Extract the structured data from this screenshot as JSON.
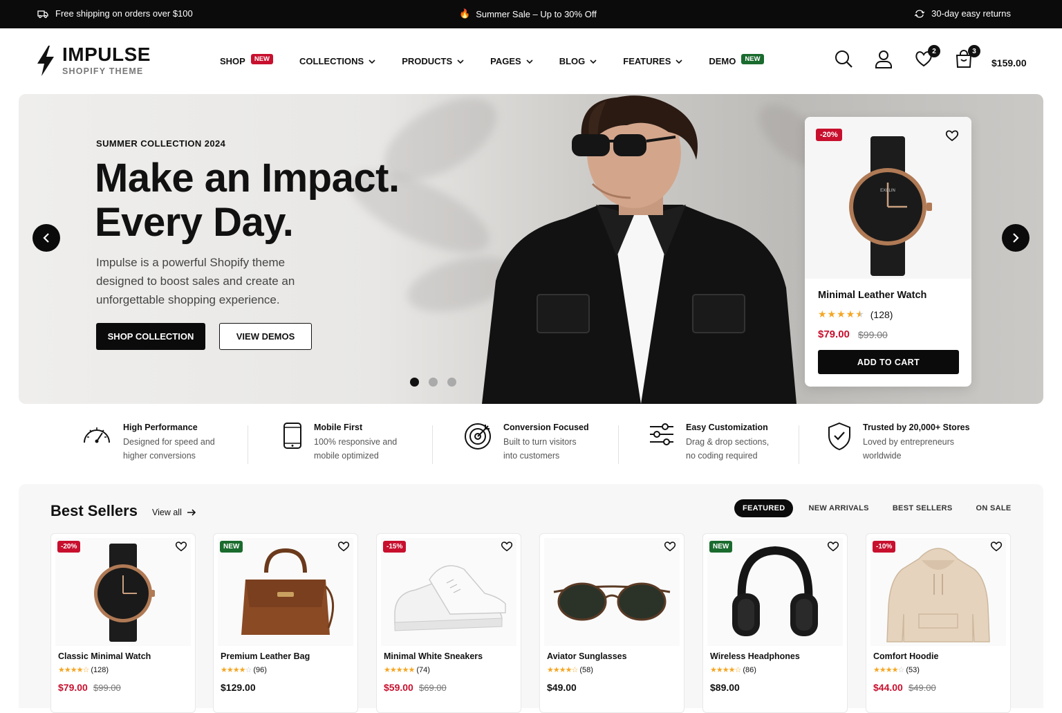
{
  "topbar": {
    "shipping": "Free shipping on orders over $100",
    "sale": "Summer Sale – Up to 30% Off",
    "returns": "30-day easy returns"
  },
  "logo": {
    "name": "IMPULSE",
    "tagline": "SHOPIFY THEME"
  },
  "nav": [
    {
      "label": "SHOP",
      "badge": "NEW",
      "badge_color": "#c8102e"
    },
    {
      "label": "COLLECTIONS",
      "chevron": true
    },
    {
      "label": "PRODUCTS",
      "chevron": true
    },
    {
      "label": "PAGES",
      "chevron": true
    },
    {
      "label": "BLOG",
      "chevron": true
    },
    {
      "label": "FEATURES",
      "chevron": true
    },
    {
      "label": "DEMO",
      "badge": "NEW",
      "badge_color": "#1a6b2e"
    }
  ],
  "header": {
    "wishlist_count": "2",
    "cart_count": "3",
    "cart_total": "$159.00"
  },
  "hero": {
    "kicker": "SUMMER COLLECTION 2024",
    "title_line1": "Make an Impact.",
    "title_line2": "Every Day.",
    "description": "Impulse is a powerful Shopify theme designed to boost sales and create an unforgettable shopping experience.",
    "primary_button": "SHOP COLLECTION",
    "secondary_button": "VIEW DEMOS",
    "slides": 3,
    "active_slide": 0,
    "product": {
      "discount": "-20%",
      "name": "Minimal Leather Watch",
      "rating": 4.5,
      "reviews": "(128)",
      "price": "$79.00",
      "old_price": "$99.00",
      "button": "ADD TO CART"
    }
  },
  "features": [
    {
      "title": "High Performance",
      "line1": "Designed for speed and",
      "line2": "higher conversions",
      "icon": "speedometer-icon"
    },
    {
      "title": "Mobile First",
      "line1": "100% responsive and",
      "line2": "mobile optimized",
      "icon": "mobile-icon"
    },
    {
      "title": "Conversion Focused",
      "line1": "Built to turn visitors",
      "line2": "into customers",
      "icon": "target-icon"
    },
    {
      "title": "Easy Customization",
      "line1": "Drag & drop sections,",
      "line2": "no coding required",
      "icon": "sliders-icon"
    },
    {
      "title": "Trusted by 20,000+ Stores",
      "line1": "Loved by entrepreneurs",
      "line2": "worldwide",
      "icon": "shield-check-icon"
    }
  ],
  "best_sellers": {
    "title": "Best Sellers",
    "view_all": "View all",
    "tabs": [
      "FEATURED",
      "NEW ARRIVALS",
      "BEST SELLERS",
      "ON SALE"
    ],
    "active_tab": 0,
    "products": [
      {
        "name": "Classic Minimal Watch",
        "badge": "-20%",
        "badge_color": "#c8102e",
        "rating": 4.5,
        "reviews": "(128)",
        "price": "$79.00",
        "old_price": "$99.00",
        "sale": true,
        "image": "watch-image"
      },
      {
        "name": "Premium Leather Bag",
        "badge": "NEW",
        "badge_color": "#1a6b2e",
        "rating": 4,
        "reviews": "(96)",
        "price": "$129.00",
        "old_price": "",
        "sale": false,
        "image": "bag-image"
      },
      {
        "name": "Minimal White Sneakers",
        "badge": "-15%",
        "badge_color": "#c8102e",
        "rating": 5,
        "reviews": "(74)",
        "price": "$59.00",
        "old_price": "$69.00",
        "sale": true,
        "image": "sneakers-image"
      },
      {
        "name": "Aviator Sunglasses",
        "badge": "",
        "badge_color": "",
        "rating": 4.5,
        "reviews": "(58)",
        "price": "$49.00",
        "old_price": "",
        "sale": false,
        "image": "sunglasses-image"
      },
      {
        "name": "Wireless Headphones",
        "badge": "NEW",
        "badge_color": "#1a6b2e",
        "rating": 4.5,
        "reviews": "(86)",
        "price": "$89.00",
        "old_price": "",
        "sale": false,
        "image": "headphones-image"
      },
      {
        "name": "Comfort Hoodie",
        "badge": "-10%",
        "badge_color": "#c8102e",
        "rating": 4,
        "reviews": "(53)",
        "price": "$44.00",
        "old_price": "$49.00",
        "sale": true,
        "image": "hoodie-image"
      }
    ]
  },
  "colors": {
    "sale_red": "#c8102e",
    "new_green": "#1a6b2e",
    "star": "#f5a623",
    "dark": "#0b0b0b"
  }
}
